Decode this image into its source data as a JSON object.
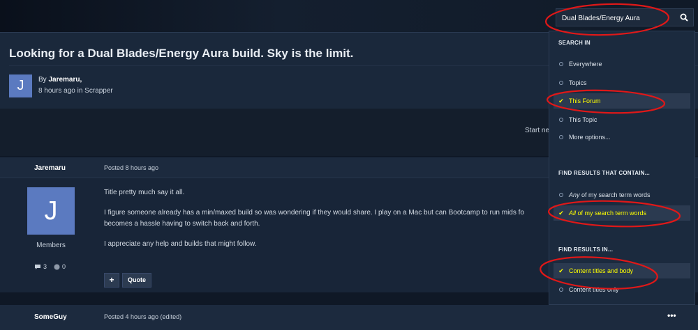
{
  "search": {
    "query": "Dual Blades/Energy Aura",
    "button_icon": "search-icon"
  },
  "topic": {
    "title": "Looking for a Dual Blades/Energy Aura build. Sky is the limit.",
    "author_initial": "J",
    "by_label": "By",
    "author": "Jaremaru,",
    "meta": "8 hours ago in Scrapper"
  },
  "band": {
    "start_new": "Start ne"
  },
  "post1": {
    "author": "Jaremaru",
    "posted": "Posted 8 hours ago",
    "avatar_initial": "J",
    "group": "Members",
    "posts_count": "3",
    "rep_count": "0",
    "paragraphs": [
      "Title pretty much say it all.",
      "I figure someone already has a min/maxed build so was wondering if they would share.  I play on a Mac but can Bootcamp to run mids fo becomes a hassle having to switch back and forth.",
      "I appreciate any help and builds that might follow."
    ],
    "plus_label": "+",
    "quote_label": "Quote"
  },
  "post2": {
    "author": "SomeGuy",
    "posted": "Posted 4 hours ago (edited)",
    "more": "•••"
  },
  "dropdown": {
    "search_in_label": "SEARCH IN",
    "search_in": [
      {
        "label": "Everywhere",
        "selected": false
      },
      {
        "label": "Topics",
        "selected": false
      },
      {
        "label": "This Forum",
        "selected": true
      },
      {
        "label": "This Topic",
        "selected": false
      },
      {
        "label": "More options...",
        "selected": false
      }
    ],
    "contain_label": "FIND RESULTS THAT CONTAIN...",
    "contain": [
      {
        "em": "Any",
        "rest": " of my search term words",
        "selected": false
      },
      {
        "em": "All",
        "rest": " of my search term words",
        "selected": true
      }
    ],
    "in_label": "FIND RESULTS IN...",
    "in": [
      {
        "label": "Content titles and body",
        "selected": true
      },
      {
        "label": "Content titles only",
        "selected": false
      }
    ]
  },
  "colors": {
    "highlight_text": "#ffff00",
    "annotation": "#e01818",
    "avatar": "#5b7ac0"
  }
}
